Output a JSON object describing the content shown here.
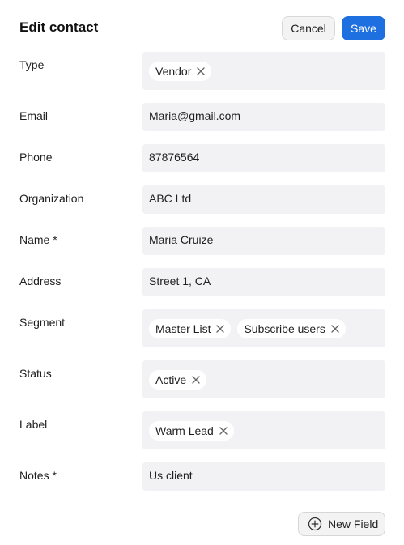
{
  "header": {
    "title": "Edit contact",
    "cancel_label": "Cancel",
    "save_label": "Save"
  },
  "fields": {
    "type": {
      "label": "Type",
      "chips": [
        "Vendor"
      ]
    },
    "email": {
      "label": "Email",
      "value": "Maria@gmail.com"
    },
    "phone": {
      "label": "Phone",
      "value": "87876564"
    },
    "organization": {
      "label": "Organization",
      "value": "ABC Ltd"
    },
    "name": {
      "label": "Name *",
      "value": "Maria Cruize"
    },
    "address": {
      "label": "Address",
      "value": "Street 1, CA"
    },
    "segment": {
      "label": "Segment",
      "chips": [
        "Master List",
        "Subscribe users"
      ]
    },
    "status": {
      "label": "Status",
      "chips": [
        "Active"
      ]
    },
    "label": {
      "label": "Label",
      "chips": [
        "Warm Lead"
      ]
    },
    "notes": {
      "label": "Notes *",
      "value": "Us client"
    }
  },
  "footer": {
    "new_field_label": "New Field"
  },
  "icons": {
    "chip_remove": "close-icon",
    "new_field": "plus-circle-icon"
  },
  "colors": {
    "accent": "#1e6fe0",
    "field_bg": "#f2f2f4"
  }
}
